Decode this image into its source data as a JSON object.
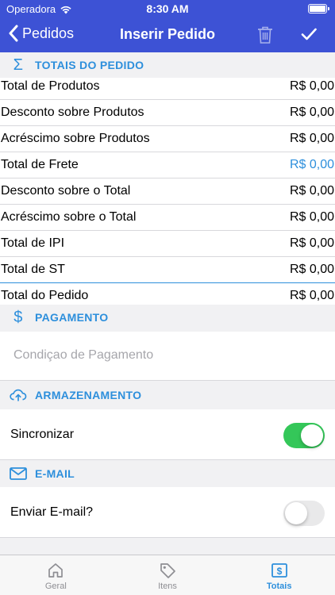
{
  "status_bar": {
    "carrier": "Operadora",
    "time": "8:30 AM"
  },
  "nav": {
    "back_label": "Pedidos",
    "title": "Inserir Pedido"
  },
  "totals": {
    "header": "TOTAIS DO PEDIDO",
    "rows": [
      {
        "label": "Total de Produtos",
        "value": "R$ 0,00"
      },
      {
        "label": "Desconto sobre Produtos",
        "value": "R$ 0,00"
      },
      {
        "label": "Acréscimo sobre Produtos",
        "value": "R$ 0,00"
      },
      {
        "label": "Total de Frete",
        "value": "R$ 0,00"
      },
      {
        "label": "Desconto sobre o Total",
        "value": "R$ 0,00"
      },
      {
        "label": "Acréscimo sobre o Total",
        "value": "R$ 0,00"
      },
      {
        "label": "Total de IPI",
        "value": "R$ 0,00"
      },
      {
        "label": "Total de ST",
        "value": "R$ 0,00"
      },
      {
        "label": "Total do Pedido",
        "value": "R$ 0,00"
      }
    ]
  },
  "payment": {
    "header": "PAGAMENTO",
    "placeholder": "Condiçao de Pagamento"
  },
  "storage": {
    "header": "ARMAZENAMENTO",
    "sync_label": "Sincronizar",
    "sync_on": true
  },
  "email": {
    "header": "E-MAIL",
    "send_label": "Enviar E-mail?",
    "send_on": false
  },
  "tabs": [
    {
      "label": "Geral",
      "icon": "home-icon"
    },
    {
      "label": "Itens",
      "icon": "tag-icon"
    },
    {
      "label": "Totais",
      "icon": "dollar-box-icon"
    }
  ],
  "colors": {
    "nav": "#3d52d5",
    "accent": "#2d8fdc",
    "switch_on": "#34c759"
  }
}
